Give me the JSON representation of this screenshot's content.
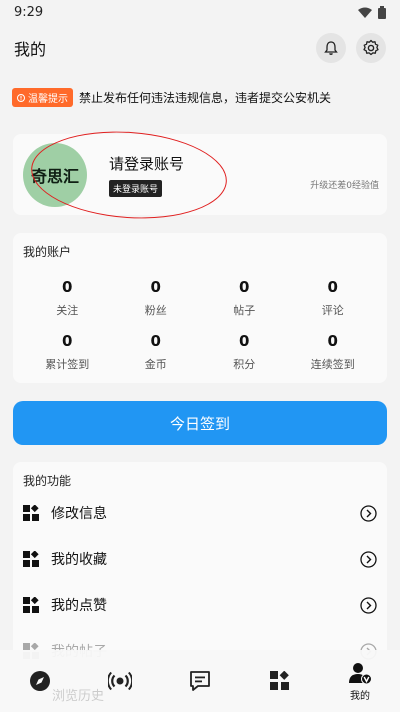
{
  "status_bar": {
    "time": "9:29"
  },
  "header": {
    "title": "我的"
  },
  "notice": {
    "badge": "温馨提示",
    "text": "禁止发布任何违法违规信息，违者提交公安机关"
  },
  "profile": {
    "avatar_text": "奇思汇",
    "login_prompt": "请登录账号",
    "tag": "未登录账号",
    "level_hint": "升级还差0经验值"
  },
  "account": {
    "title": "我的账户",
    "stats": [
      {
        "value": "0",
        "label": "关注"
      },
      {
        "value": "0",
        "label": "粉丝"
      },
      {
        "value": "0",
        "label": "帖子"
      },
      {
        "value": "0",
        "label": "评论"
      },
      {
        "value": "0",
        "label": "累计签到"
      },
      {
        "value": "0",
        "label": "金币"
      },
      {
        "value": "0",
        "label": "积分"
      },
      {
        "value": "0",
        "label": "连续签到"
      }
    ]
  },
  "checkin": {
    "label": "今日签到"
  },
  "functions": {
    "title": "我的功能",
    "items": [
      {
        "label": "修改信息"
      },
      {
        "label": "我的收藏"
      },
      {
        "label": "我的点赞"
      },
      {
        "label": "我的帖子"
      }
    ],
    "partial_item": "浏览历史"
  },
  "bottom_nav": {
    "items": [
      {
        "icon": "compass-icon",
        "label": ""
      },
      {
        "icon": "broadcast-icon",
        "label": ""
      },
      {
        "icon": "message-icon",
        "label": ""
      },
      {
        "icon": "apps-icon",
        "label": ""
      },
      {
        "icon": "user-v-icon",
        "label": "我的"
      }
    ]
  },
  "colors": {
    "accent": "#2196f3",
    "notice": "#ff6a2a",
    "avatar_bg": "#9fcfa5",
    "annotation": "#e02020"
  }
}
